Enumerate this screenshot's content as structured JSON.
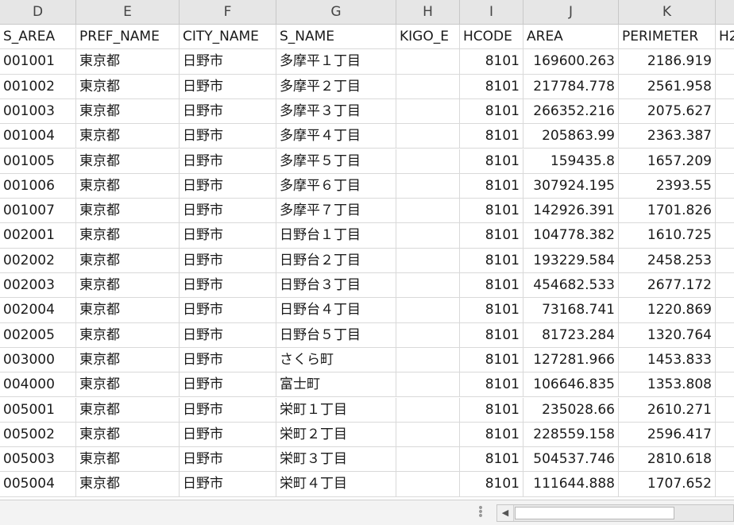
{
  "columns": [
    {
      "letter": "D"
    },
    {
      "letter": "E"
    },
    {
      "letter": "F"
    },
    {
      "letter": "G"
    },
    {
      "letter": "H"
    },
    {
      "letter": "I"
    },
    {
      "letter": "J"
    },
    {
      "letter": "K"
    },
    {
      "letter": ""
    }
  ],
  "header_row": [
    "S_AREA",
    "PREF_NAME",
    "CITY_NAME",
    "S_NAME",
    "KIGO_E",
    "HCODE",
    "AREA",
    "PERIMETER",
    "H2"
  ],
  "rows": [
    [
      "001001",
      "東京都",
      "日野市",
      "多摩平１丁目",
      "",
      "8101",
      "169600.263",
      "2186.919"
    ],
    [
      "001002",
      "東京都",
      "日野市",
      "多摩平２丁目",
      "",
      "8101",
      "217784.778",
      "2561.958"
    ],
    [
      "001003",
      "東京都",
      "日野市",
      "多摩平３丁目",
      "",
      "8101",
      "266352.216",
      "2075.627"
    ],
    [
      "001004",
      "東京都",
      "日野市",
      "多摩平４丁目",
      "",
      "8101",
      "205863.99",
      "2363.387"
    ],
    [
      "001005",
      "東京都",
      "日野市",
      "多摩平５丁目",
      "",
      "8101",
      "159435.8",
      "1657.209"
    ],
    [
      "001006",
      "東京都",
      "日野市",
      "多摩平６丁目",
      "",
      "8101",
      "307924.195",
      "2393.55"
    ],
    [
      "001007",
      "東京都",
      "日野市",
      "多摩平７丁目",
      "",
      "8101",
      "142926.391",
      "1701.826"
    ],
    [
      "002001",
      "東京都",
      "日野市",
      "日野台１丁目",
      "",
      "8101",
      "104778.382",
      "1610.725"
    ],
    [
      "002002",
      "東京都",
      "日野市",
      "日野台２丁目",
      "",
      "8101",
      "193229.584",
      "2458.253"
    ],
    [
      "002003",
      "東京都",
      "日野市",
      "日野台３丁目",
      "",
      "8101",
      "454682.533",
      "2677.172"
    ],
    [
      "002004",
      "東京都",
      "日野市",
      "日野台４丁目",
      "",
      "8101",
      "73168.741",
      "1220.869"
    ],
    [
      "002005",
      "東京都",
      "日野市",
      "日野台５丁目",
      "",
      "8101",
      "81723.284",
      "1320.764"
    ],
    [
      "003000",
      "東京都",
      "日野市",
      "さくら町",
      "",
      "8101",
      "127281.966",
      "1453.833"
    ],
    [
      "004000",
      "東京都",
      "日野市",
      "富士町",
      "",
      "8101",
      "106646.835",
      "1353.808"
    ],
    [
      "005001",
      "東京都",
      "日野市",
      "栄町１丁目",
      "",
      "8101",
      "235028.66",
      "2610.271"
    ],
    [
      "005002",
      "東京都",
      "日野市",
      "栄町２丁目",
      "",
      "8101",
      "228559.158",
      "2596.417"
    ],
    [
      "005003",
      "東京都",
      "日野市",
      "栄町３丁目",
      "",
      "8101",
      "504537.746",
      "2810.618"
    ],
    [
      "005004",
      "東京都",
      "日野市",
      "栄町４丁目",
      "",
      "8101",
      "111644.888",
      "1707.652"
    ]
  ],
  "scrollbar": {
    "left_arrow": "◀"
  }
}
